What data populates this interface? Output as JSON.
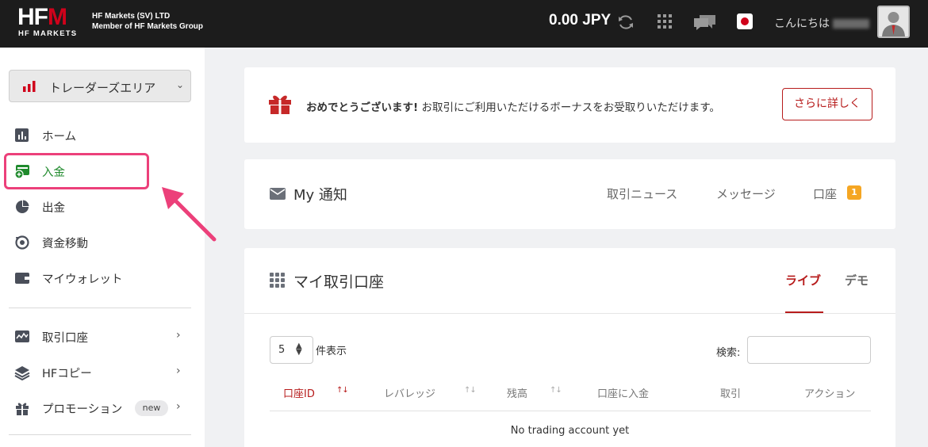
{
  "header": {
    "logo_text_hf": "HF",
    "logo_text_m": "M",
    "logo_sub": "HF MARKETS",
    "company_line1": "HF Markets (SV) LTD",
    "company_line2": "Member of HF Markets Group",
    "balance": "0.00 JPY",
    "greeting": "こんにちは"
  },
  "sidebar": {
    "area_select": "トレーダーズエリア",
    "items": [
      {
        "label": "ホーム"
      },
      {
        "label": "入金"
      },
      {
        "label": "出金"
      },
      {
        "label": "資金移動"
      },
      {
        "label": "マイウォレット"
      },
      {
        "label": "取引口座"
      },
      {
        "label": "HFコピー"
      },
      {
        "label": "プロモーション",
        "badge": "new"
      }
    ]
  },
  "bonus": {
    "bold": "おめでとうございます!",
    "text": " お取引にご利用いただけるボーナスをお受取りいただけます。",
    "button": "さらに詳しく"
  },
  "notifications": {
    "title": "My 通知",
    "tabs": [
      "取引ニュース",
      "メッセージ",
      "口座"
    ],
    "account_count": "1"
  },
  "accounts": {
    "title": "マイ取引口座",
    "tab_live": "ライブ",
    "tab_demo": "デモ",
    "page_length": "5",
    "page_length_label": "件表示",
    "search_label": "検索:",
    "columns": [
      "口座ID",
      "レバレッジ",
      "残高",
      "口座に入金",
      "取引",
      "アクション"
    ],
    "empty_message": "No trading account yet"
  },
  "colors": {
    "brand_red": "#b71c1c",
    "highlight_pink": "#ec407a",
    "active_green": "#1f8a2c",
    "badge_orange": "#f5a623"
  }
}
